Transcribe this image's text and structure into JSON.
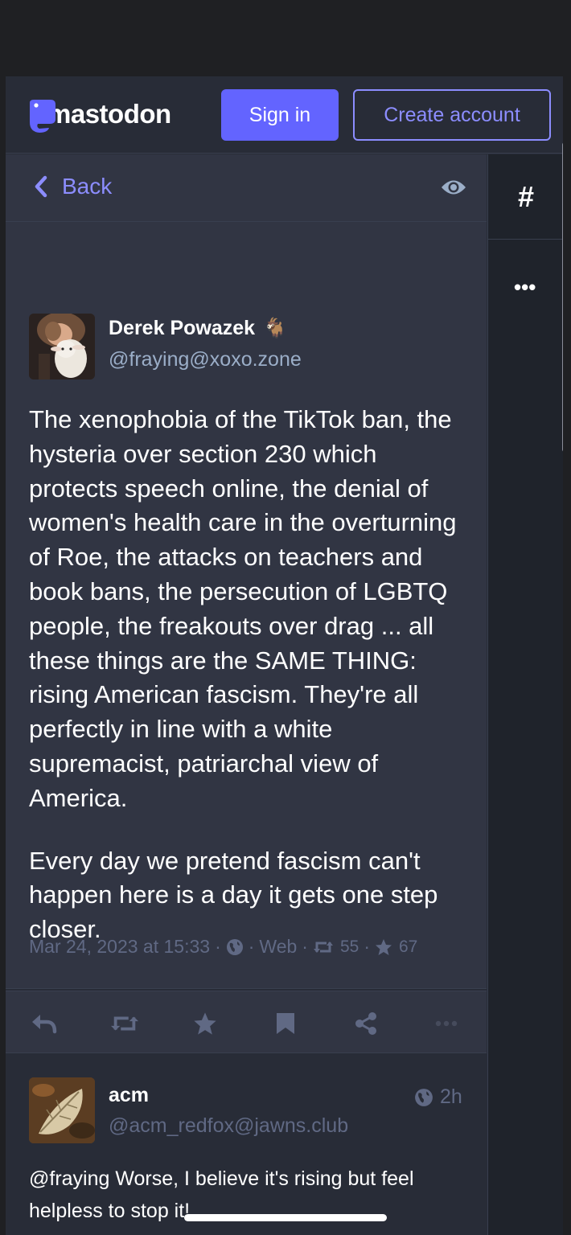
{
  "header": {
    "logo_text": "mastodon",
    "signin_label": "Sign in",
    "create_label": "Create account"
  },
  "column": {
    "back_label": "Back"
  },
  "right_column": {
    "hashtag_glyph": "#",
    "more_glyph": "•••"
  },
  "status": {
    "display_name": "Derek Powazek",
    "name_emoji": "🐐",
    "acct": "@fraying@xoxo.zone",
    "paragraphs": [
      "The xenophobia of the TikTok ban, the hysteria over section 230 which protects speech online, the denial of women's health care in the overturning of Roe, the attacks on teachers and book bans, the persecution of LGBTQ people, the freakouts over drag ... all these things are the SAME THING: rising American fascism. They're all perfectly in line with a white supremacist, patriarchal view of America.",
      "Every day we pretend fascism can't happen here is a day it gets one step closer."
    ],
    "timestamp": "Mar 24, 2023 at 15:33",
    "application": "Web",
    "boosts": "55",
    "favourites": "67"
  },
  "reply": {
    "display_name": "acm",
    "acct": "@acm_redfox@jawns.club",
    "relative_time": "2h",
    "text": "@fraying Worse, I believe it's rising but feel helpless to stop it!"
  },
  "colors": {
    "accent": "#6364ff",
    "accent_text": "#8c8dff",
    "bg": "#282c37",
    "muted": "#606984"
  }
}
